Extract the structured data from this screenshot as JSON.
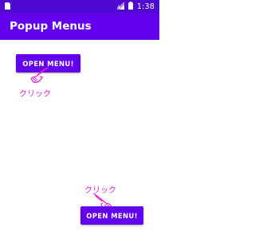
{
  "statusbar": {
    "time": "1:38",
    "icons": [
      "sim-card-icon",
      "signal-icon",
      "battery-icon"
    ]
  },
  "appbar": {
    "title": "Popup Menus"
  },
  "buttons": {
    "top_label": "OPEN MENU!",
    "bottom_label": "OPEN MENU!"
  },
  "annotations": {
    "top_click": "クリック",
    "bottom_click": "クリック"
  },
  "colors": {
    "statusbar": "#4f09d1",
    "appbar": "#6200ee",
    "button": "#6200ee",
    "annotation": "#e81fcf"
  }
}
